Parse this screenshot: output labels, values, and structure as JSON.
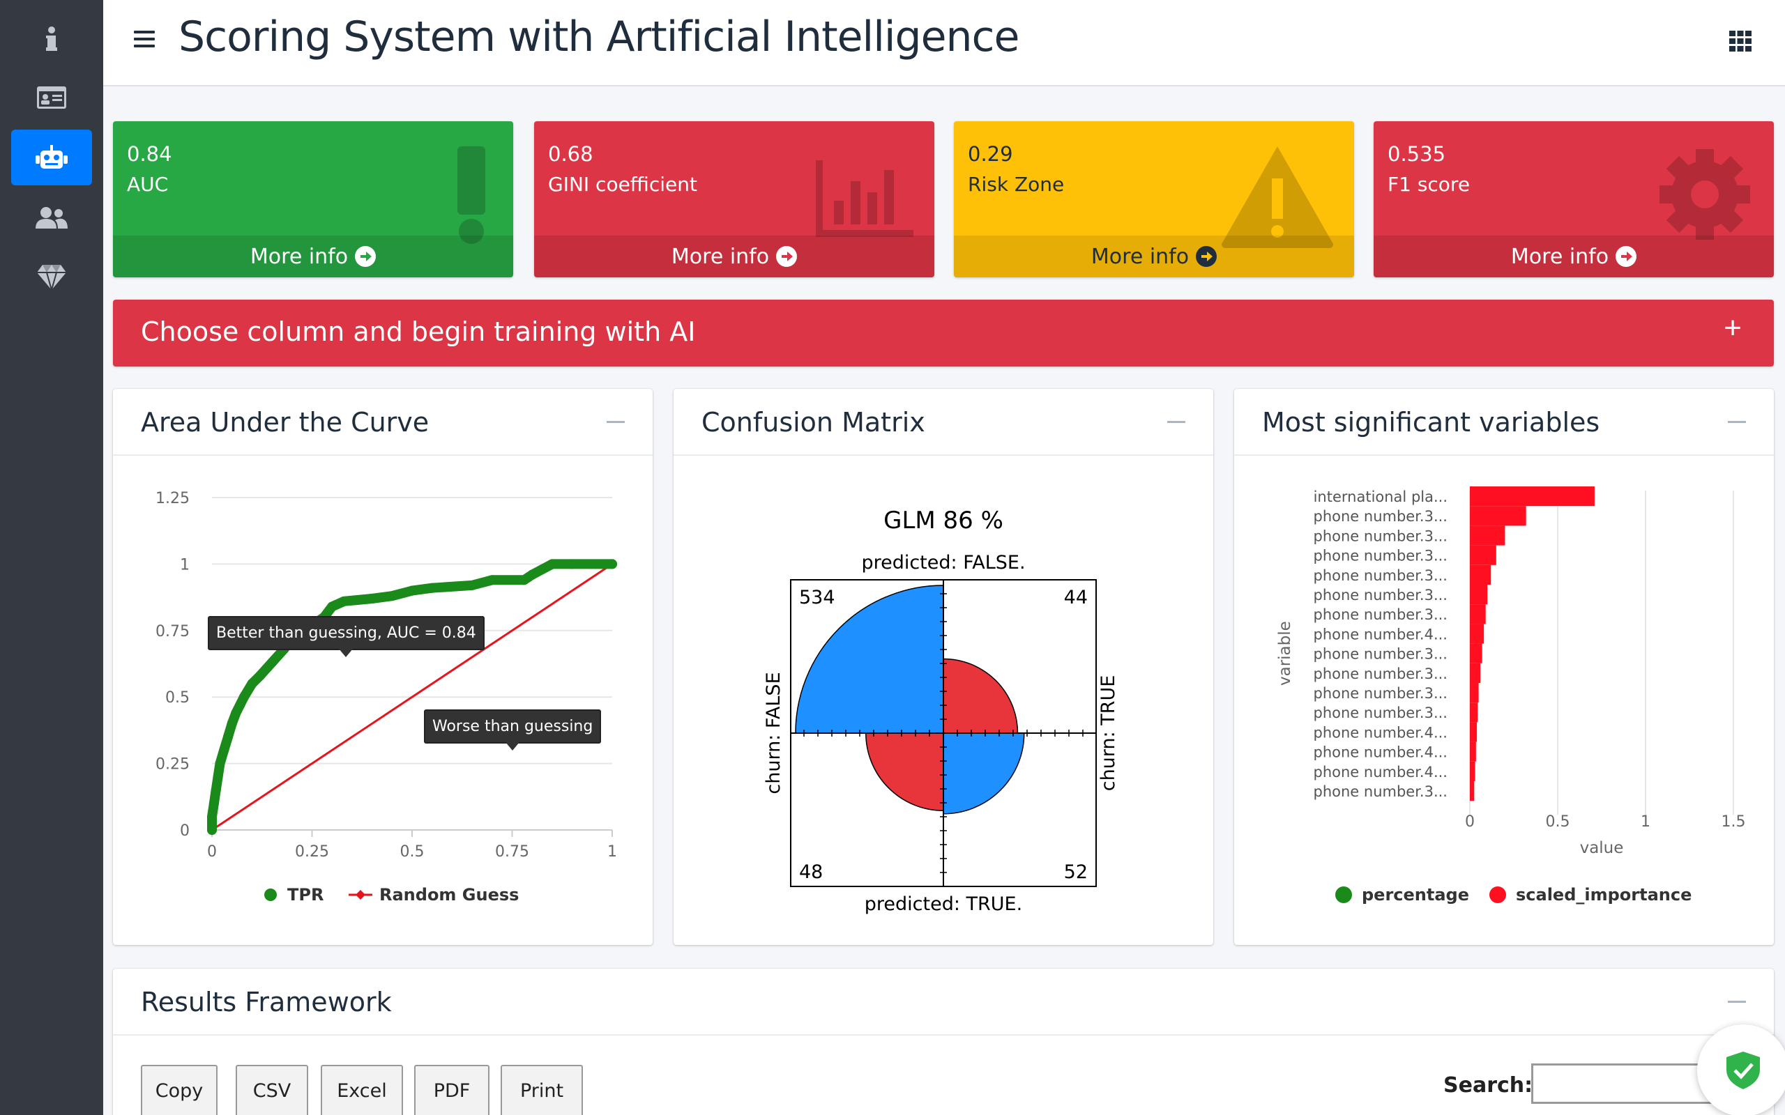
{
  "header": {
    "title": "Scoring System with Artificial Intelligence"
  },
  "sidebar": {
    "items": [
      {
        "icon": "info-icon"
      },
      {
        "icon": "id-card-icon"
      },
      {
        "icon": "robot-icon",
        "active": true
      },
      {
        "icon": "users-icon"
      },
      {
        "icon": "gem-icon"
      }
    ]
  },
  "info_boxes": [
    {
      "value": "0.84",
      "label": "AUC",
      "footer": "More info",
      "color": "#28a745",
      "icon": "exclamation-icon"
    },
    {
      "value": "0.68",
      "label": "GINI coefficient",
      "footer": "More info",
      "color": "#dc3545",
      "icon": "bar-chart-icon"
    },
    {
      "value": "0.29",
      "label": "Risk Zone",
      "footer": "More info",
      "color": "#ffc107",
      "icon": "warning-icon"
    },
    {
      "value": "0.535",
      "label": "F1 score",
      "footer": "More info",
      "color": "#dc3545",
      "icon": "gear-icon"
    }
  ],
  "banner": {
    "title": "Choose column and begin training with AI",
    "toggle": "+"
  },
  "cards": {
    "auc": {
      "title": "Area Under the Curve"
    },
    "confusion": {
      "title": "Confusion Matrix"
    },
    "variables": {
      "title": "Most significant variables"
    },
    "results": {
      "title": "Results Framework"
    }
  },
  "chart_data": [
    {
      "type": "line",
      "x_ticks": [
        "0",
        "0.25",
        "0.5",
        "0.75",
        "1"
      ],
      "y_ticks": [
        "0",
        "0.25",
        "0.5",
        "0.75",
        "1",
        "1.25"
      ],
      "ylim": [
        0,
        1.25
      ],
      "xlim": [
        0,
        1
      ],
      "series": [
        {
          "name": "TPR",
          "color": "#1a8a1a",
          "x": [
            0,
            0.0,
            0.005,
            0.01,
            0.015,
            0.02,
            0.03,
            0.04,
            0.05,
            0.06,
            0.07,
            0.08,
            0.1,
            0.12,
            0.15,
            0.18,
            0.2,
            0.22,
            0.25,
            0.28,
            0.3,
            0.33,
            0.4,
            0.45,
            0.5,
            0.55,
            0.65,
            0.7,
            0.78,
            0.8,
            0.85,
            0.9,
            1.0
          ],
          "y": [
            0,
            0.05,
            0.1,
            0.15,
            0.2,
            0.25,
            0.3,
            0.35,
            0.4,
            0.44,
            0.47,
            0.5,
            0.55,
            0.58,
            0.63,
            0.68,
            0.72,
            0.75,
            0.77,
            0.8,
            0.84,
            0.86,
            0.87,
            0.88,
            0.9,
            0.91,
            0.92,
            0.94,
            0.94,
            0.96,
            1.0,
            1.0,
            1.0
          ]
        },
        {
          "name": "Random Guess",
          "color": "#e8141c",
          "x": [
            0,
            1
          ],
          "y": [
            0,
            1
          ]
        }
      ],
      "tooltips": [
        "Better than guessing, AUC = 0.84",
        "Worse than guessing"
      ],
      "grid": true,
      "legend": "bottom"
    },
    {
      "type": "fourfold",
      "title": "GLM 86 %",
      "top_label": "predicted: FALSE.",
      "bottom_label": "predicted: TRUE.",
      "left_label": "churn: FALSE",
      "right_label": "churn: TRUE",
      "cells": [
        {
          "count": "534",
          "value": 534,
          "quadrant": "top-left",
          "color": "#1e90ff"
        },
        {
          "count": "44",
          "value": 44,
          "quadrant": "top-right",
          "color": "#e8353b"
        },
        {
          "count": "48",
          "value": 48,
          "quadrant": "bottom-left",
          "color": "#e8353b"
        },
        {
          "count": "52",
          "value": 52,
          "quadrant": "bottom-right",
          "color": "#1e90ff"
        }
      ]
    },
    {
      "type": "bar",
      "orientation": "horizontal",
      "xlabel": "value",
      "ylabel": "variable",
      "x_ticks": [
        "0",
        "0.5",
        "1",
        "1.5"
      ],
      "xlim": [
        0,
        1.5
      ],
      "categories": [
        "international pla...",
        "phone number.3...",
        "phone number.3...",
        "phone number.3...",
        "phone number.3...",
        "phone number.3...",
        "phone number.3...",
        "phone number.4...",
        "phone number.3...",
        "phone number.3...",
        "phone number.3...",
        "phone number.3...",
        "phone number.4...",
        "phone number.4...",
        "phone number.4...",
        "phone number.3..."
      ],
      "values": [
        0.71,
        0.32,
        0.2,
        0.15,
        0.12,
        0.1,
        0.09,
        0.08,
        0.07,
        0.06,
        0.05,
        0.045,
        0.04,
        0.035,
        0.03,
        0.025
      ],
      "series": [
        {
          "name": "percentage",
          "color": "#1a8a1a"
        },
        {
          "name": "scaled_importance",
          "color": "#ff0f1f"
        }
      ],
      "legend": "bottom"
    }
  ],
  "results": {
    "buttons": [
      "Copy",
      "CSV",
      "Excel",
      "PDF",
      "Print"
    ],
    "search_label": "Search:",
    "search_value": ""
  }
}
